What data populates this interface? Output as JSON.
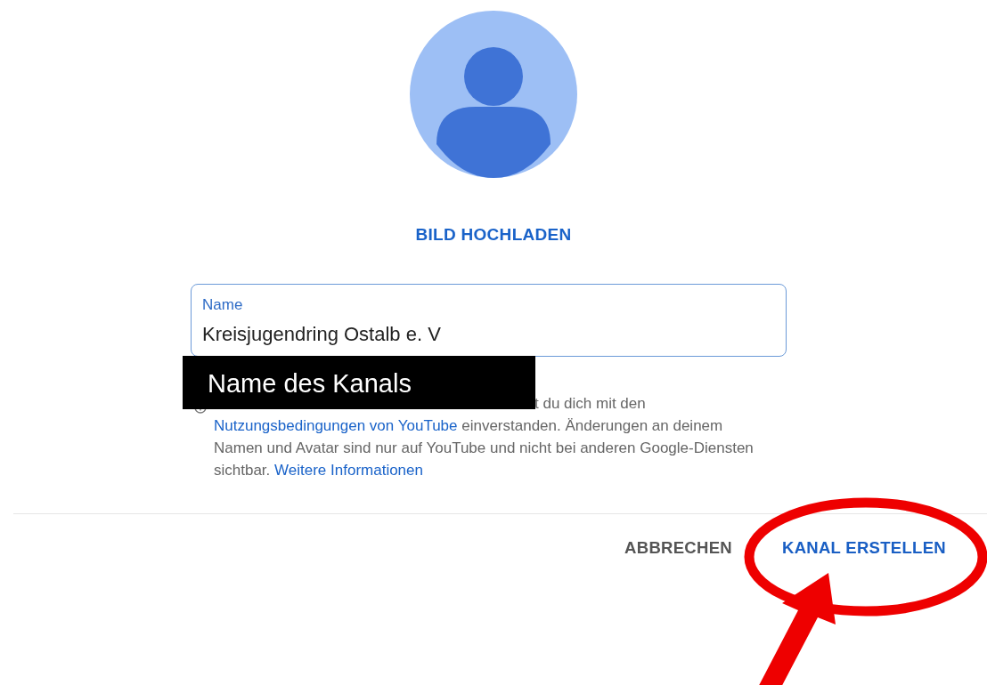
{
  "upload_button": "BILD HOCHLADEN",
  "name_field": {
    "label": "Name",
    "value": "Kreisjugendring Ostalb e. V"
  },
  "info": {
    "fragment": "t du dich mit den",
    "link_1": "Nutzungsbedingungen von YouTube",
    "text_1": " einverstanden. Änderungen an deinem Namen und Avatar sind nur auf YouTube und nicht bei anderen Google-Diensten sichtbar. ",
    "link_2": "Weitere Informationen"
  },
  "buttons": [
    {
      "label": "ABBRECHEN",
      "kind": "secondary"
    },
    {
      "label": "KANAL ERSTELLEN",
      "kind": "primary"
    }
  ],
  "annotation": {
    "label": "Name des Kanals"
  }
}
